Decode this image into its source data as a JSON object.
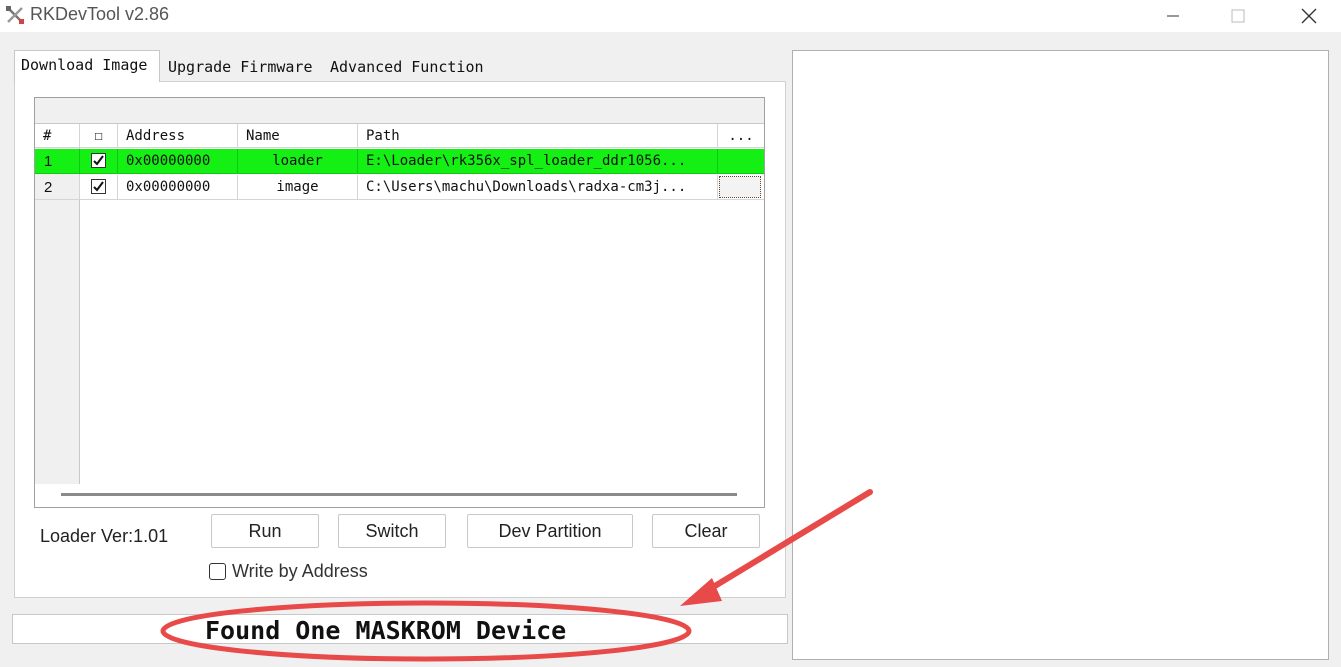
{
  "window": {
    "title": "RKDevTool v2.86",
    "icon": "rk-tools-icon",
    "controls": [
      "minimize-icon",
      "maximize-icon",
      "close-icon"
    ]
  },
  "tabs": [
    {
      "label": "Download Image",
      "active": true
    },
    {
      "label": "Upgrade Firmware",
      "active": false
    },
    {
      "label": "Advanced Function",
      "active": false
    }
  ],
  "table": {
    "columns": [
      "#",
      "☐",
      "Address",
      "Name",
      "Path",
      "..."
    ],
    "rows": [
      {
        "num": "1",
        "checked": true,
        "address": "0x00000000",
        "name": "loader",
        "path": "E:\\Loader\\rk356x_spl_loader_ddr1056...",
        "selected": true
      },
      {
        "num": "2",
        "checked": true,
        "address": "0x00000000",
        "name": "image",
        "path": "C:\\Users\\machu\\Downloads\\radxa-cm3j...",
        "selected": false
      }
    ]
  },
  "loader_version": "Loader Ver:1.01",
  "buttons": {
    "run": "Run",
    "switch": "Switch",
    "dev_partition": "Dev Partition",
    "clear": "Clear"
  },
  "write_by_address": {
    "label": "Write by Address",
    "checked": false
  },
  "status": "Found One MASKROM Device",
  "colors": {
    "selected_row": "#14f014",
    "annotation": "#e84a4a",
    "background": "#f0f0f0"
  }
}
